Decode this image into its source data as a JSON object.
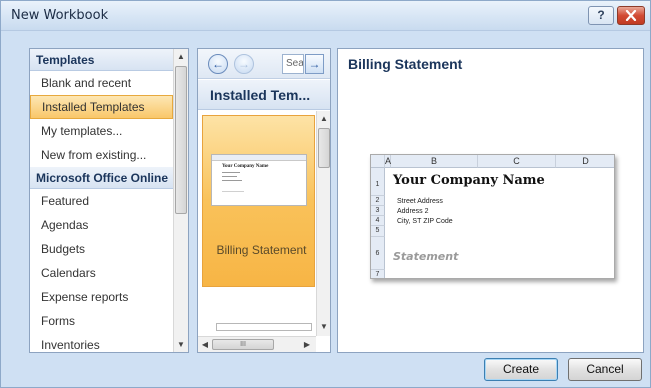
{
  "window": {
    "title": "New Workbook",
    "help_label": "?",
    "close_icon": "close-icon"
  },
  "sidebar": {
    "sections": [
      {
        "header": "Templates"
      },
      {
        "header": "Microsoft Office Online"
      }
    ],
    "items": [
      {
        "label": "Blank and recent"
      },
      {
        "label": "Installed Templates",
        "selected": true
      },
      {
        "label": "My templates..."
      },
      {
        "label": "New from existing..."
      },
      {
        "label": "Featured"
      },
      {
        "label": "Agendas"
      },
      {
        "label": "Budgets"
      },
      {
        "label": "Calendars"
      },
      {
        "label": "Expense reports"
      },
      {
        "label": "Forms"
      },
      {
        "label": "Inventories"
      }
    ]
  },
  "middle": {
    "search_value": "Sea",
    "header": "Installed Tem...",
    "templates": [
      {
        "label": "Billing Statement",
        "selected": true
      }
    ],
    "scroll_glyph": "III"
  },
  "preview": {
    "title": "Billing Statement",
    "sheet": {
      "columns": [
        "A",
        "B",
        "C",
        "D"
      ],
      "rows": [
        "1",
        "2",
        "3",
        "4",
        "5",
        "6",
        "7"
      ],
      "company": "Your Company Name",
      "address_lines": [
        "Street Address",
        "Address 2",
        "City, ST  ZIP Code"
      ],
      "statement": "Statement"
    }
  },
  "buttons": {
    "create": "Create",
    "cancel": "Cancel"
  },
  "colors": {
    "selection": "#f9c76a",
    "header_text": "#1b355b",
    "window_bg": "#cfe0f3"
  }
}
